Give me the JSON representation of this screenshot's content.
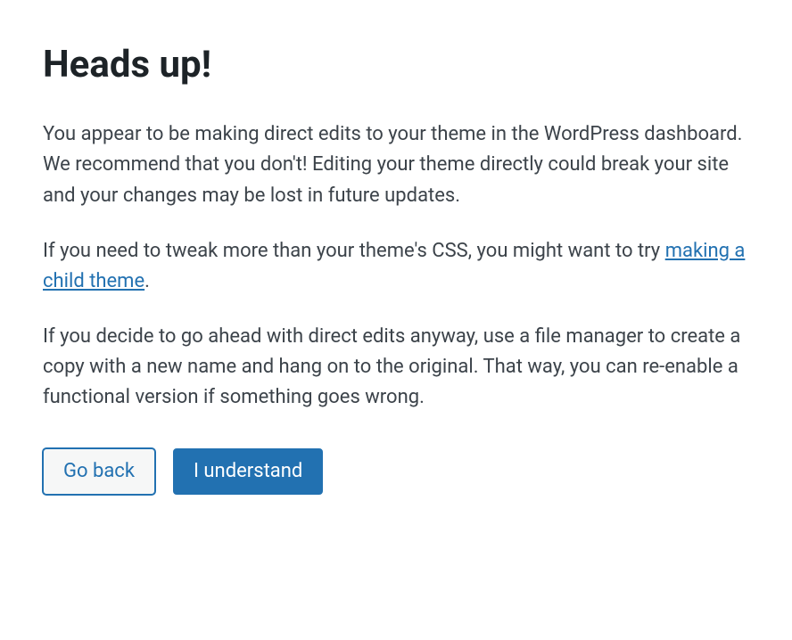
{
  "modal": {
    "title": "Heads up!",
    "paragraph1": "You appear to be making direct edits to your theme in the WordPress dashboard. We recommend that you don't! Editing your theme directly could break your site and your changes may be lost in future updates.",
    "paragraph2_before_link": "If you need to tweak more than your theme's CSS, you might want to try ",
    "paragraph2_link_text": "making a child theme",
    "paragraph2_after_link": ".",
    "paragraph3": "If you decide to go ahead with direct edits anyway, use a file manager to create a copy with a new name and hang on to the original. That way, you can re-enable a functional version if something goes wrong.",
    "buttons": {
      "go_back": "Go back",
      "understand": "I understand"
    }
  }
}
